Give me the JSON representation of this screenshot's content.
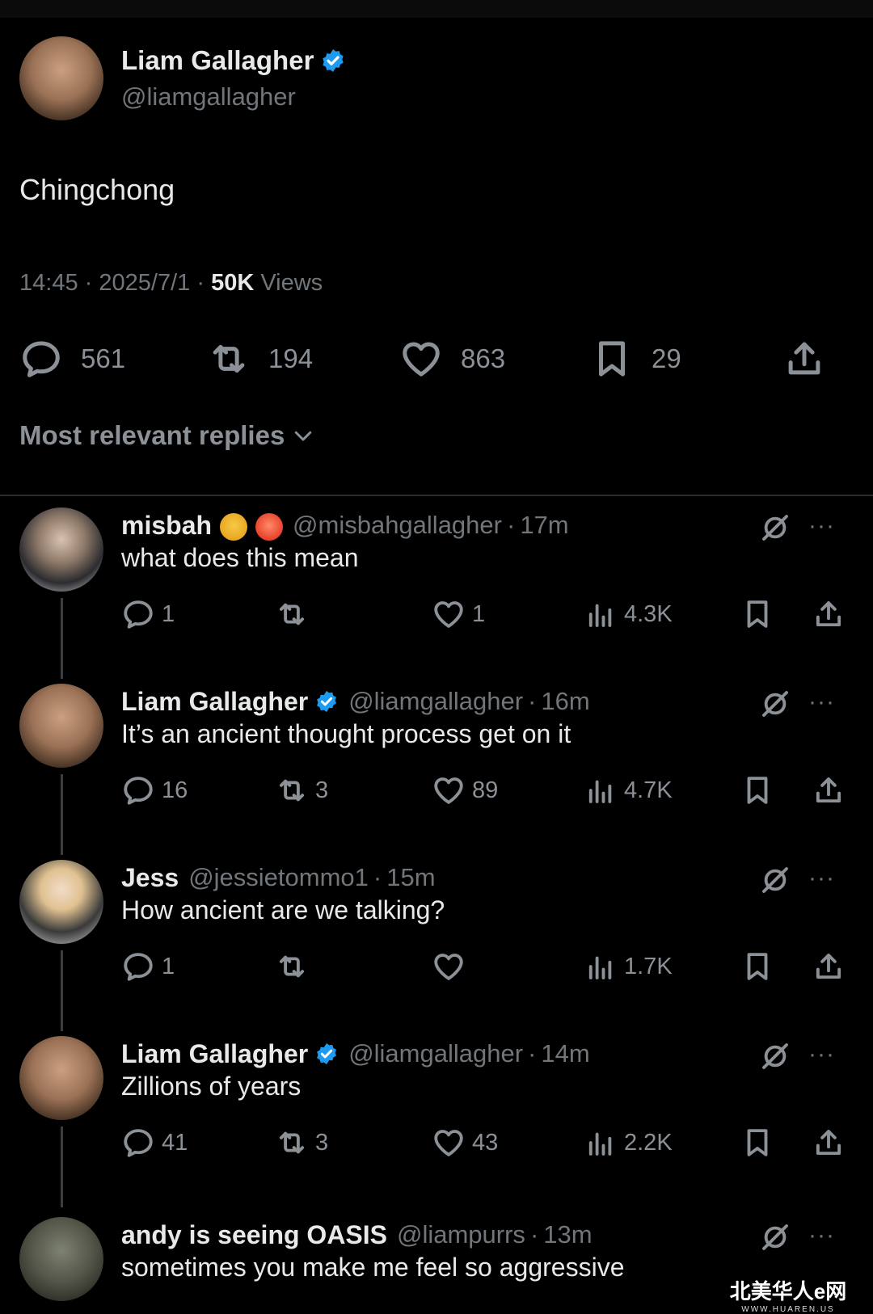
{
  "main_tweet": {
    "author_name": "Liam Gallagher",
    "author_handle": "@liamgallagher",
    "text": "Chingchong",
    "time": "14:45",
    "date": "2025/7/1",
    "views_count": "50K",
    "views_label": "Views",
    "replies": "561",
    "retweets": "194",
    "likes": "863",
    "bookmarks": "29"
  },
  "replies_section": {
    "sort_label": "Most relevant replies"
  },
  "replies": [
    {
      "name": "misbah",
      "handle": "@misbahgallagher",
      "time": "17m",
      "text": "what does this mean",
      "replies": "1",
      "retweets": "",
      "likes": "1",
      "views": "4.3K"
    },
    {
      "name": "Liam Gallagher",
      "handle": "@liamgallagher",
      "time": "16m",
      "text": "It’s an ancient thought process get on it",
      "replies": "16",
      "retweets": "3",
      "likes": "89",
      "views": "4.7K"
    },
    {
      "name": "Jess",
      "handle": "@jessietommo1",
      "time": "15m",
      "text": "How ancient are we talking?",
      "replies": "1",
      "retweets": "",
      "likes": "",
      "views": "1.7K"
    },
    {
      "name": "Liam Gallagher",
      "handle": "@liamgallagher",
      "time": "14m",
      "text": "Zillions of years",
      "replies": "41",
      "retweets": "3",
      "likes": "43",
      "views": "2.2K"
    },
    {
      "name": "andy is seeing OASIS",
      "handle": "@liampurrs",
      "time": "13m",
      "text": "sometimes you make me feel so aggressive"
    }
  ],
  "separator": "·",
  "more_label": "···",
  "watermark": {
    "main": "北美华人e网",
    "sub": "WWW.HUAREN.US"
  },
  "colors": {
    "background": "#000000",
    "text": "#e7e9ea",
    "muted": "#71767b",
    "verified": "#1d9bf0"
  }
}
